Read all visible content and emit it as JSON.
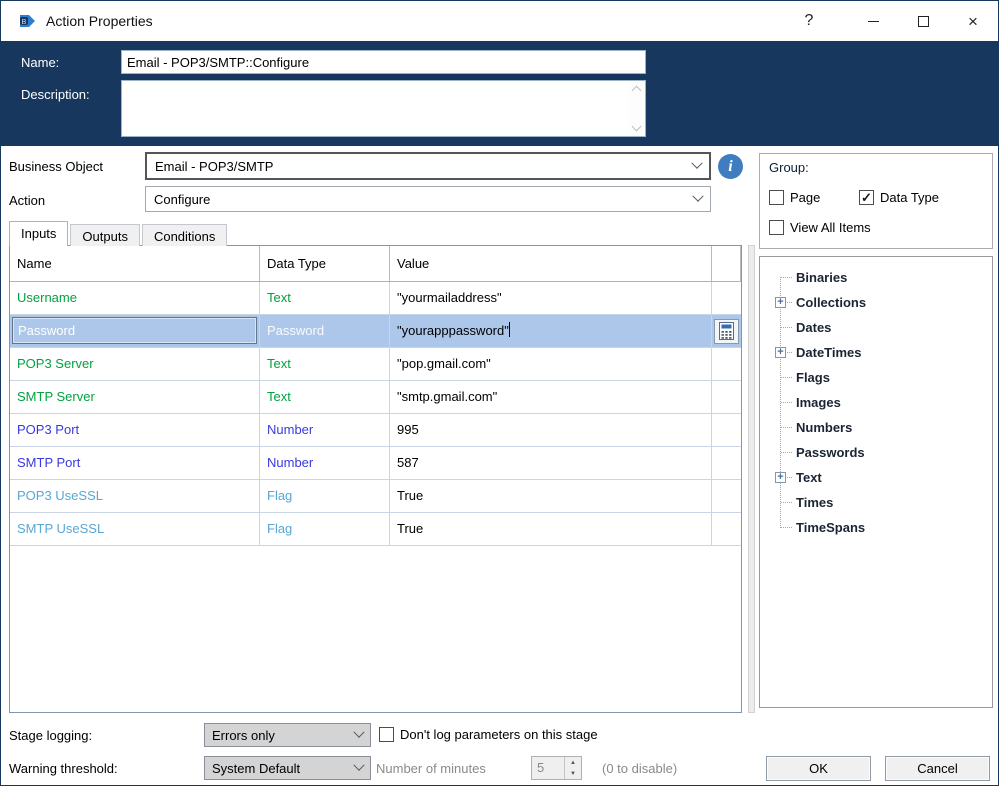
{
  "window": {
    "title": "Action Properties"
  },
  "icons": {
    "help": "?",
    "close": "×",
    "check": "✓",
    "plus": "+",
    "info": "i"
  },
  "header": {
    "name_label": "Name:",
    "name_value": "Email - POP3/SMTP::Configure",
    "description_label": "Description:",
    "description_value": ""
  },
  "selectors": {
    "business_object_label": "Business Object",
    "business_object_value": "Email - POP3/SMTP",
    "action_label": "Action",
    "action_value": "Configure"
  },
  "tabs": [
    {
      "label": "Inputs",
      "active": true
    },
    {
      "label": "Outputs",
      "active": false
    },
    {
      "label": "Conditions",
      "active": false
    }
  ],
  "inputs_table": {
    "columns": [
      "Name",
      "Data Type",
      "Value"
    ],
    "rows": [
      {
        "name": "Username",
        "type": "Text",
        "value": "\"yourmailaddress\"",
        "kind": "text",
        "selected": false
      },
      {
        "name": "Password",
        "type": "Password",
        "value": "\"yourapppassword\"",
        "kind": "password",
        "selected": true
      },
      {
        "name": "POP3 Server",
        "type": "Text",
        "value": "\"pop.gmail.com\"",
        "kind": "text",
        "selected": false
      },
      {
        "name": "SMTP Server",
        "type": "Text",
        "value": "\"smtp.gmail.com\"",
        "kind": "text",
        "selected": false
      },
      {
        "name": "POP3 Port",
        "type": "Number",
        "value": "995",
        "kind": "number",
        "selected": false
      },
      {
        "name": "SMTP Port",
        "type": "Number",
        "value": "587",
        "kind": "number",
        "selected": false
      },
      {
        "name": "POP3 UseSSL",
        "type": "Flag",
        "value": "True",
        "kind": "flag",
        "selected": false
      },
      {
        "name": "SMTP UseSSL",
        "type": "Flag",
        "value": "True",
        "kind": "flag",
        "selected": false
      }
    ]
  },
  "group_panel": {
    "title": "Group:",
    "checkboxes": [
      {
        "label": "Page",
        "checked": false
      },
      {
        "label": "Data Type",
        "checked": true
      },
      {
        "label": "View All Items",
        "checked": false
      }
    ]
  },
  "tree": {
    "items": [
      {
        "label": "Binaries",
        "expandable": false
      },
      {
        "label": "Collections",
        "expandable": true
      },
      {
        "label": "Dates",
        "expandable": false
      },
      {
        "label": "DateTimes",
        "expandable": true
      },
      {
        "label": "Flags",
        "expandable": false
      },
      {
        "label": "Images",
        "expandable": false
      },
      {
        "label": "Numbers",
        "expandable": false
      },
      {
        "label": "Passwords",
        "expandable": false
      },
      {
        "label": "Text",
        "expandable": true
      },
      {
        "label": "Times",
        "expandable": false
      },
      {
        "label": "TimeSpans",
        "expandable": false
      }
    ]
  },
  "footer": {
    "stage_logging_label": "Stage logging:",
    "stage_logging_value": "Errors only",
    "dont_log_label": "Don't log parameters on this stage",
    "warning_threshold_label": "Warning threshold:",
    "warning_threshold_value": "System Default",
    "minutes_label": "Number of minutes",
    "minutes_value": "5",
    "disable_hint": "(0 to disable)",
    "ok_label": "OK",
    "cancel_label": "Cancel"
  },
  "colors": {
    "header_navy": "#17375E",
    "selection_blue": "#ADC7EA",
    "type_text_green": "#00A33E",
    "type_number_blue": "#3939E0",
    "type_flag_blue": "#58A7D4",
    "info_icon_blue": "#3F7CC0"
  }
}
